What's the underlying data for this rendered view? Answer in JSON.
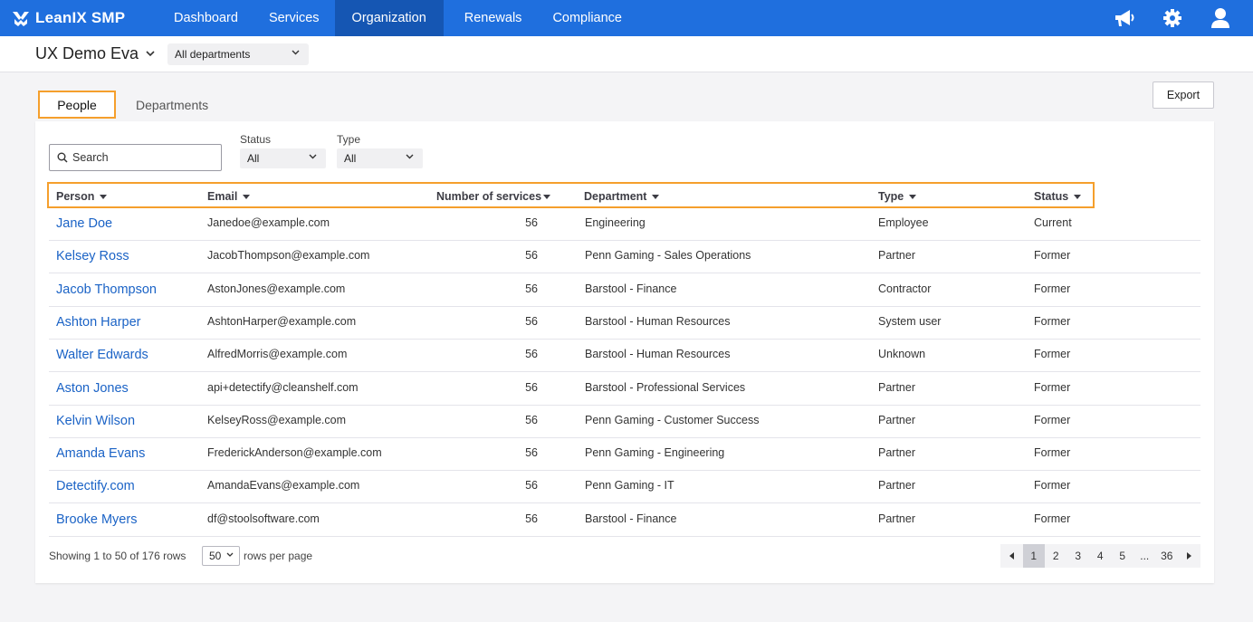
{
  "brand": {
    "name": "LeanIX SMP"
  },
  "nav": [
    {
      "label": "Dashboard",
      "active": false
    },
    {
      "label": "Services",
      "active": false
    },
    {
      "label": "Organization",
      "active": true
    },
    {
      "label": "Renewals",
      "active": false
    },
    {
      "label": "Compliance",
      "active": false
    }
  ],
  "nav_icons": [
    "megaphone-icon",
    "gear-icon",
    "user-icon"
  ],
  "workspace": {
    "name": "UX Demo Eva"
  },
  "department_filter": {
    "value": "All departments"
  },
  "tabs": {
    "people": "People",
    "departments": "Departments"
  },
  "export_label": "Export",
  "search": {
    "placeholder": "Search"
  },
  "filters": {
    "status": {
      "label": "Status",
      "value": "All"
    },
    "type": {
      "label": "Type",
      "value": "All"
    }
  },
  "columns": {
    "person": "Person",
    "email": "Email",
    "services": "Number of services",
    "department": "Department",
    "type": "Type",
    "status": "Status"
  },
  "rows": [
    {
      "person": "Jane Doe",
      "email": "Janedoe@example.com",
      "services": "56",
      "department": "Engineering",
      "type": "Employee",
      "status": "Current"
    },
    {
      "person": "Kelsey Ross",
      "email": "JacobThompson@example.com",
      "services": "56",
      "department": "Penn Gaming - Sales Operations",
      "type": "Partner",
      "status": "Former"
    },
    {
      "person": "Jacob Thompson",
      "email": "AstonJones@example.com",
      "services": "56",
      "department": "Barstool - Finance",
      "type": "Contractor",
      "status": "Former"
    },
    {
      "person": "Ashton Harper",
      "email": "AshtonHarper@example.com",
      "services": "56",
      "department": "Barstool - Human Resources",
      "type": "System user",
      "status": "Former"
    },
    {
      "person": "Walter Edwards",
      "email": "AlfredMorris@example.com",
      "services": "56",
      "department": "Barstool - Human Resources",
      "type": "Unknown",
      "status": "Former"
    },
    {
      "person": "Aston Jones",
      "email": "api+detectify@cleanshelf.com",
      "services": "56",
      "department": "Barstool - Professional Services",
      "type": "Partner",
      "status": "Former"
    },
    {
      "person": "Kelvin Wilson",
      "email": "KelseyRoss@example.com",
      "services": "56",
      "department": "Penn Gaming - Customer Success",
      "type": "Partner",
      "status": "Former"
    },
    {
      "person": "Amanda Evans",
      "email": "FrederickAnderson@example.com",
      "services": "56",
      "department": "Penn Gaming - Engineering",
      "type": "Partner",
      "status": "Former"
    },
    {
      "person": "Detectify.com",
      "email": "AmandaEvans@example.com",
      "services": "56",
      "department": "Penn Gaming - IT",
      "type": "Partner",
      "status": "Former"
    },
    {
      "person": "Brooke Myers",
      "email": "df@stoolsoftware.com",
      "services": "56",
      "department": "Barstool - Finance",
      "type": "Partner",
      "status": "Former"
    }
  ],
  "footer": {
    "showing": "Showing 1 to 50 of 176 rows",
    "rows_per_page_value": "50",
    "rows_per_page_label": "rows per page"
  },
  "pagination": {
    "pages": [
      "1",
      "2",
      "3",
      "4",
      "5",
      "...",
      "36"
    ],
    "current": "1"
  },
  "colors": {
    "nav_bg": "#1f6fde",
    "nav_active": "#1556b3",
    "link": "#1b63c6",
    "highlight": "#f59f2c"
  }
}
